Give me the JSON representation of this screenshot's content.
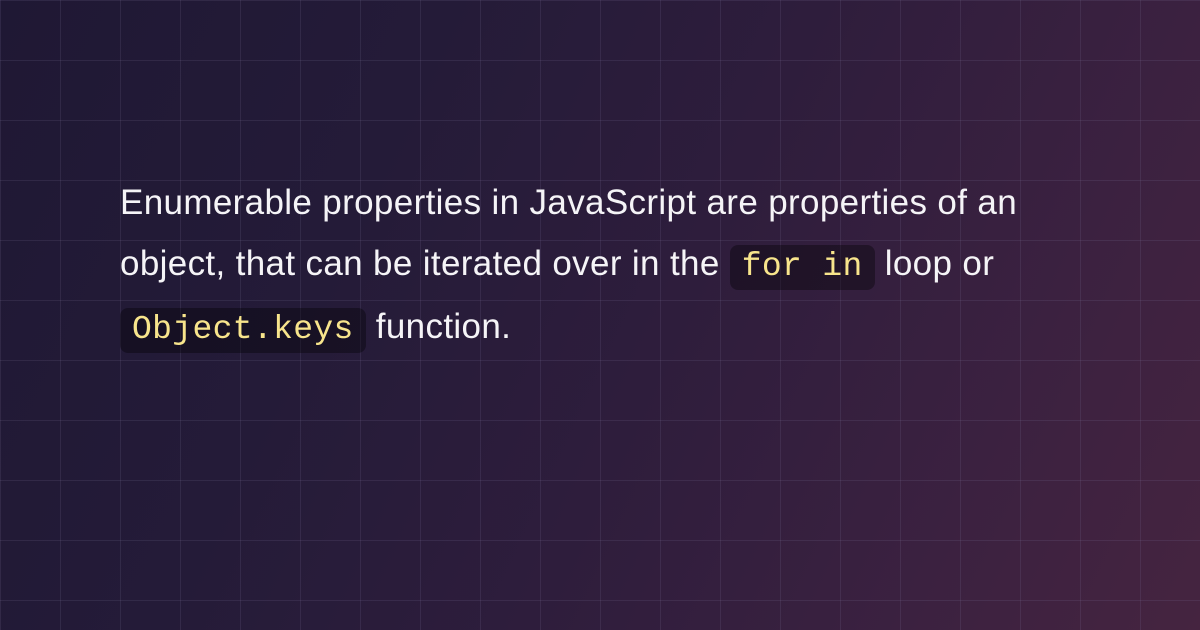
{
  "paragraph": {
    "part1": "Enumerable properties in JavaScript are properties of an object, that can be iterated over in the ",
    "code1": "for in",
    "part2": " loop or ",
    "code2": "Object.keys",
    "part3": " function."
  }
}
